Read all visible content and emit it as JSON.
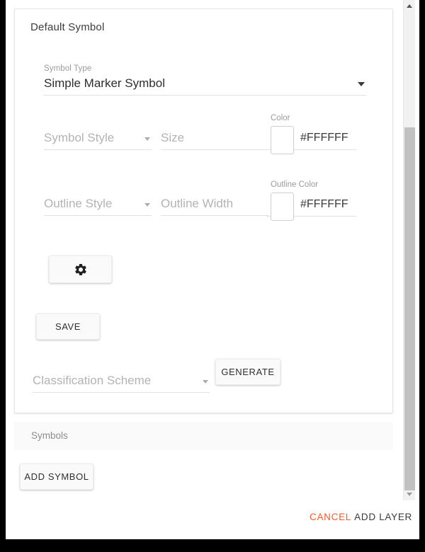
{
  "card": {
    "title": "Default Symbol",
    "symbol_type": {
      "label": "Symbol Type",
      "value": "Simple Marker Symbol",
      "caret_icon": "chevron-down-icon"
    },
    "symbol_style": {
      "label": "",
      "placeholder": "Symbol Style",
      "caret_icon": "chevron-down-icon"
    },
    "size": {
      "label": "",
      "placeholder": "Size"
    },
    "color": {
      "label": "Color",
      "value": "#FFFFFF",
      "swatch_color": "#FFFFFF"
    },
    "outline_style": {
      "label": "",
      "placeholder": "Outline Style",
      "caret_icon": "chevron-down-icon"
    },
    "outline_width": {
      "label": "",
      "placeholder": "Outline Width"
    },
    "outline_color": {
      "label": "Outline Color",
      "value": "#FFFFFF",
      "swatch_color": "#FFFFFF"
    },
    "settings_button": {
      "icon": "gear-icon",
      "label": ""
    },
    "save_button": {
      "label": "SAVE"
    },
    "classification_scheme": {
      "placeholder": "Classification Scheme",
      "caret_icon": "chevron-down-icon"
    },
    "generate_button": {
      "label": "GENERATE"
    }
  },
  "symbols_section": {
    "title": "Symbols",
    "add_symbol_button": {
      "label": "ADD SYMBOL"
    }
  },
  "footer": {
    "cancel_label": "CANCEL",
    "add_layer_label": "ADD LAYER",
    "cancel_color": "#FF5722",
    "add_layer_color": "#3A3A3A"
  },
  "scrollbar": {
    "up_arrow_icon": "triangle-up-icon",
    "down_arrow_icon": "triangle-down-icon"
  }
}
